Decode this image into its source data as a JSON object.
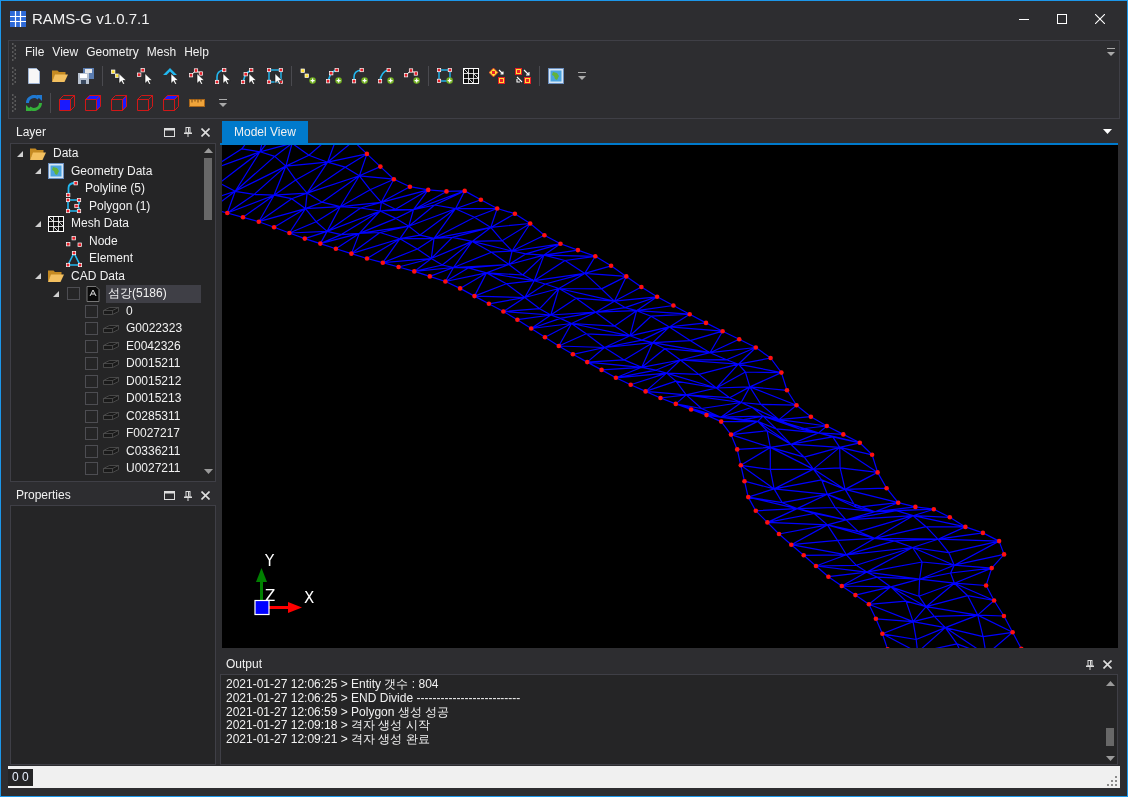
{
  "window": {
    "title": "RAMS-G v1.0.7.1"
  },
  "menu": [
    "File",
    "View",
    "Geometry",
    "Mesh",
    "Help"
  ],
  "layer_panel": {
    "title": "Layer",
    "tree": [
      {
        "label": "Data",
        "kind": "folder",
        "selected": false,
        "expanded": true,
        "children": [
          {
            "label": "Geometry Data",
            "kind": "map",
            "selected": false,
            "expanded": true,
            "children": [
              {
                "label": "Polyline (5)",
                "kind": "polyline",
                "selected": false
              },
              {
                "label": "Polygon (1)",
                "kind": "polygon",
                "selected": false
              }
            ]
          },
          {
            "label": "Mesh Data",
            "kind": "mesh",
            "selected": false,
            "expanded": true,
            "children": [
              {
                "label": "Node",
                "kind": "node",
                "selected": false
              },
              {
                "label": "Element",
                "kind": "element",
                "selected": false
              }
            ]
          },
          {
            "label": "CAD Data",
            "kind": "folder",
            "selected": false,
            "expanded": true,
            "children": [
              {
                "label": "섬강(5186)",
                "kind": "cad",
                "selected": true,
                "checked": false,
                "expanded": true,
                "children": [
                  {
                    "label": "0",
                    "kind": "layer",
                    "selected": false,
                    "checked": false
                  },
                  {
                    "label": "G0022323",
                    "kind": "layer",
                    "selected": false,
                    "checked": false
                  },
                  {
                    "label": "E0042326",
                    "kind": "layer",
                    "selected": false,
                    "checked": false
                  },
                  {
                    "label": "D0015211",
                    "kind": "layer",
                    "selected": false,
                    "checked": false
                  },
                  {
                    "label": "D0015212",
                    "kind": "layer",
                    "selected": false,
                    "checked": false
                  },
                  {
                    "label": "D0015213",
                    "kind": "layer",
                    "selected": false,
                    "checked": false
                  },
                  {
                    "label": "C0285311",
                    "kind": "layer",
                    "selected": false,
                    "checked": false
                  },
                  {
                    "label": "F0027217",
                    "kind": "layer",
                    "selected": false,
                    "checked": false
                  },
                  {
                    "label": "C0336211",
                    "kind": "layer",
                    "selected": false,
                    "checked": false
                  },
                  {
                    "label": "U0027211",
                    "kind": "layer",
                    "selected": false,
                    "checked": false
                  }
                ]
              }
            ]
          }
        ]
      }
    ]
  },
  "properties_panel": {
    "title": "Properties"
  },
  "tabs": [
    {
      "label": "Model View",
      "selected": true
    }
  ],
  "model_view": {
    "axes": {
      "x": "X",
      "y": "Y",
      "z": "Z"
    }
  },
  "output_panel": {
    "title": "Output",
    "lines": [
      "2021-01-27 12:06:25 > Entity 갯수 : 804",
      "2021-01-27 12:06:25 > END Divide --------------------------",
      "2021-01-27 12:06:59 > Polygon 생성 성공",
      "2021-01-27 12:09:18 > 격자 생성 시작",
      "2021-01-27 12:09:21 > 격자 생성 완료"
    ]
  },
  "status_bar": {
    "coordinates": "0 0"
  }
}
